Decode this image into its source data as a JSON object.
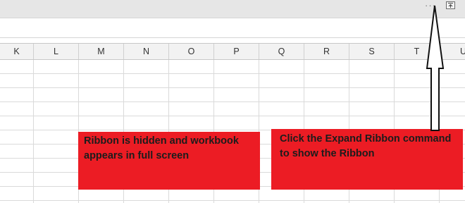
{
  "ribbon_bar": {
    "more_options_icon": "ellipsis-icon",
    "more_options_label": "···",
    "expand_ribbon_icon": "expand-ribbon-icon"
  },
  "columns": [
    "K",
    "L",
    "M",
    "N",
    "O",
    "P",
    "Q",
    "R",
    "S",
    "T",
    "U"
  ],
  "callouts": {
    "left_text": "Ribbon is hidden and workbook appears in full screen",
    "right_text": "Click the Expand Ribbon command to show the Ribbon"
  },
  "colors": {
    "callout_red": "#ec1c24",
    "header_gray": "#f2f2f2",
    "titlebar_gray": "#e6e6e6"
  }
}
